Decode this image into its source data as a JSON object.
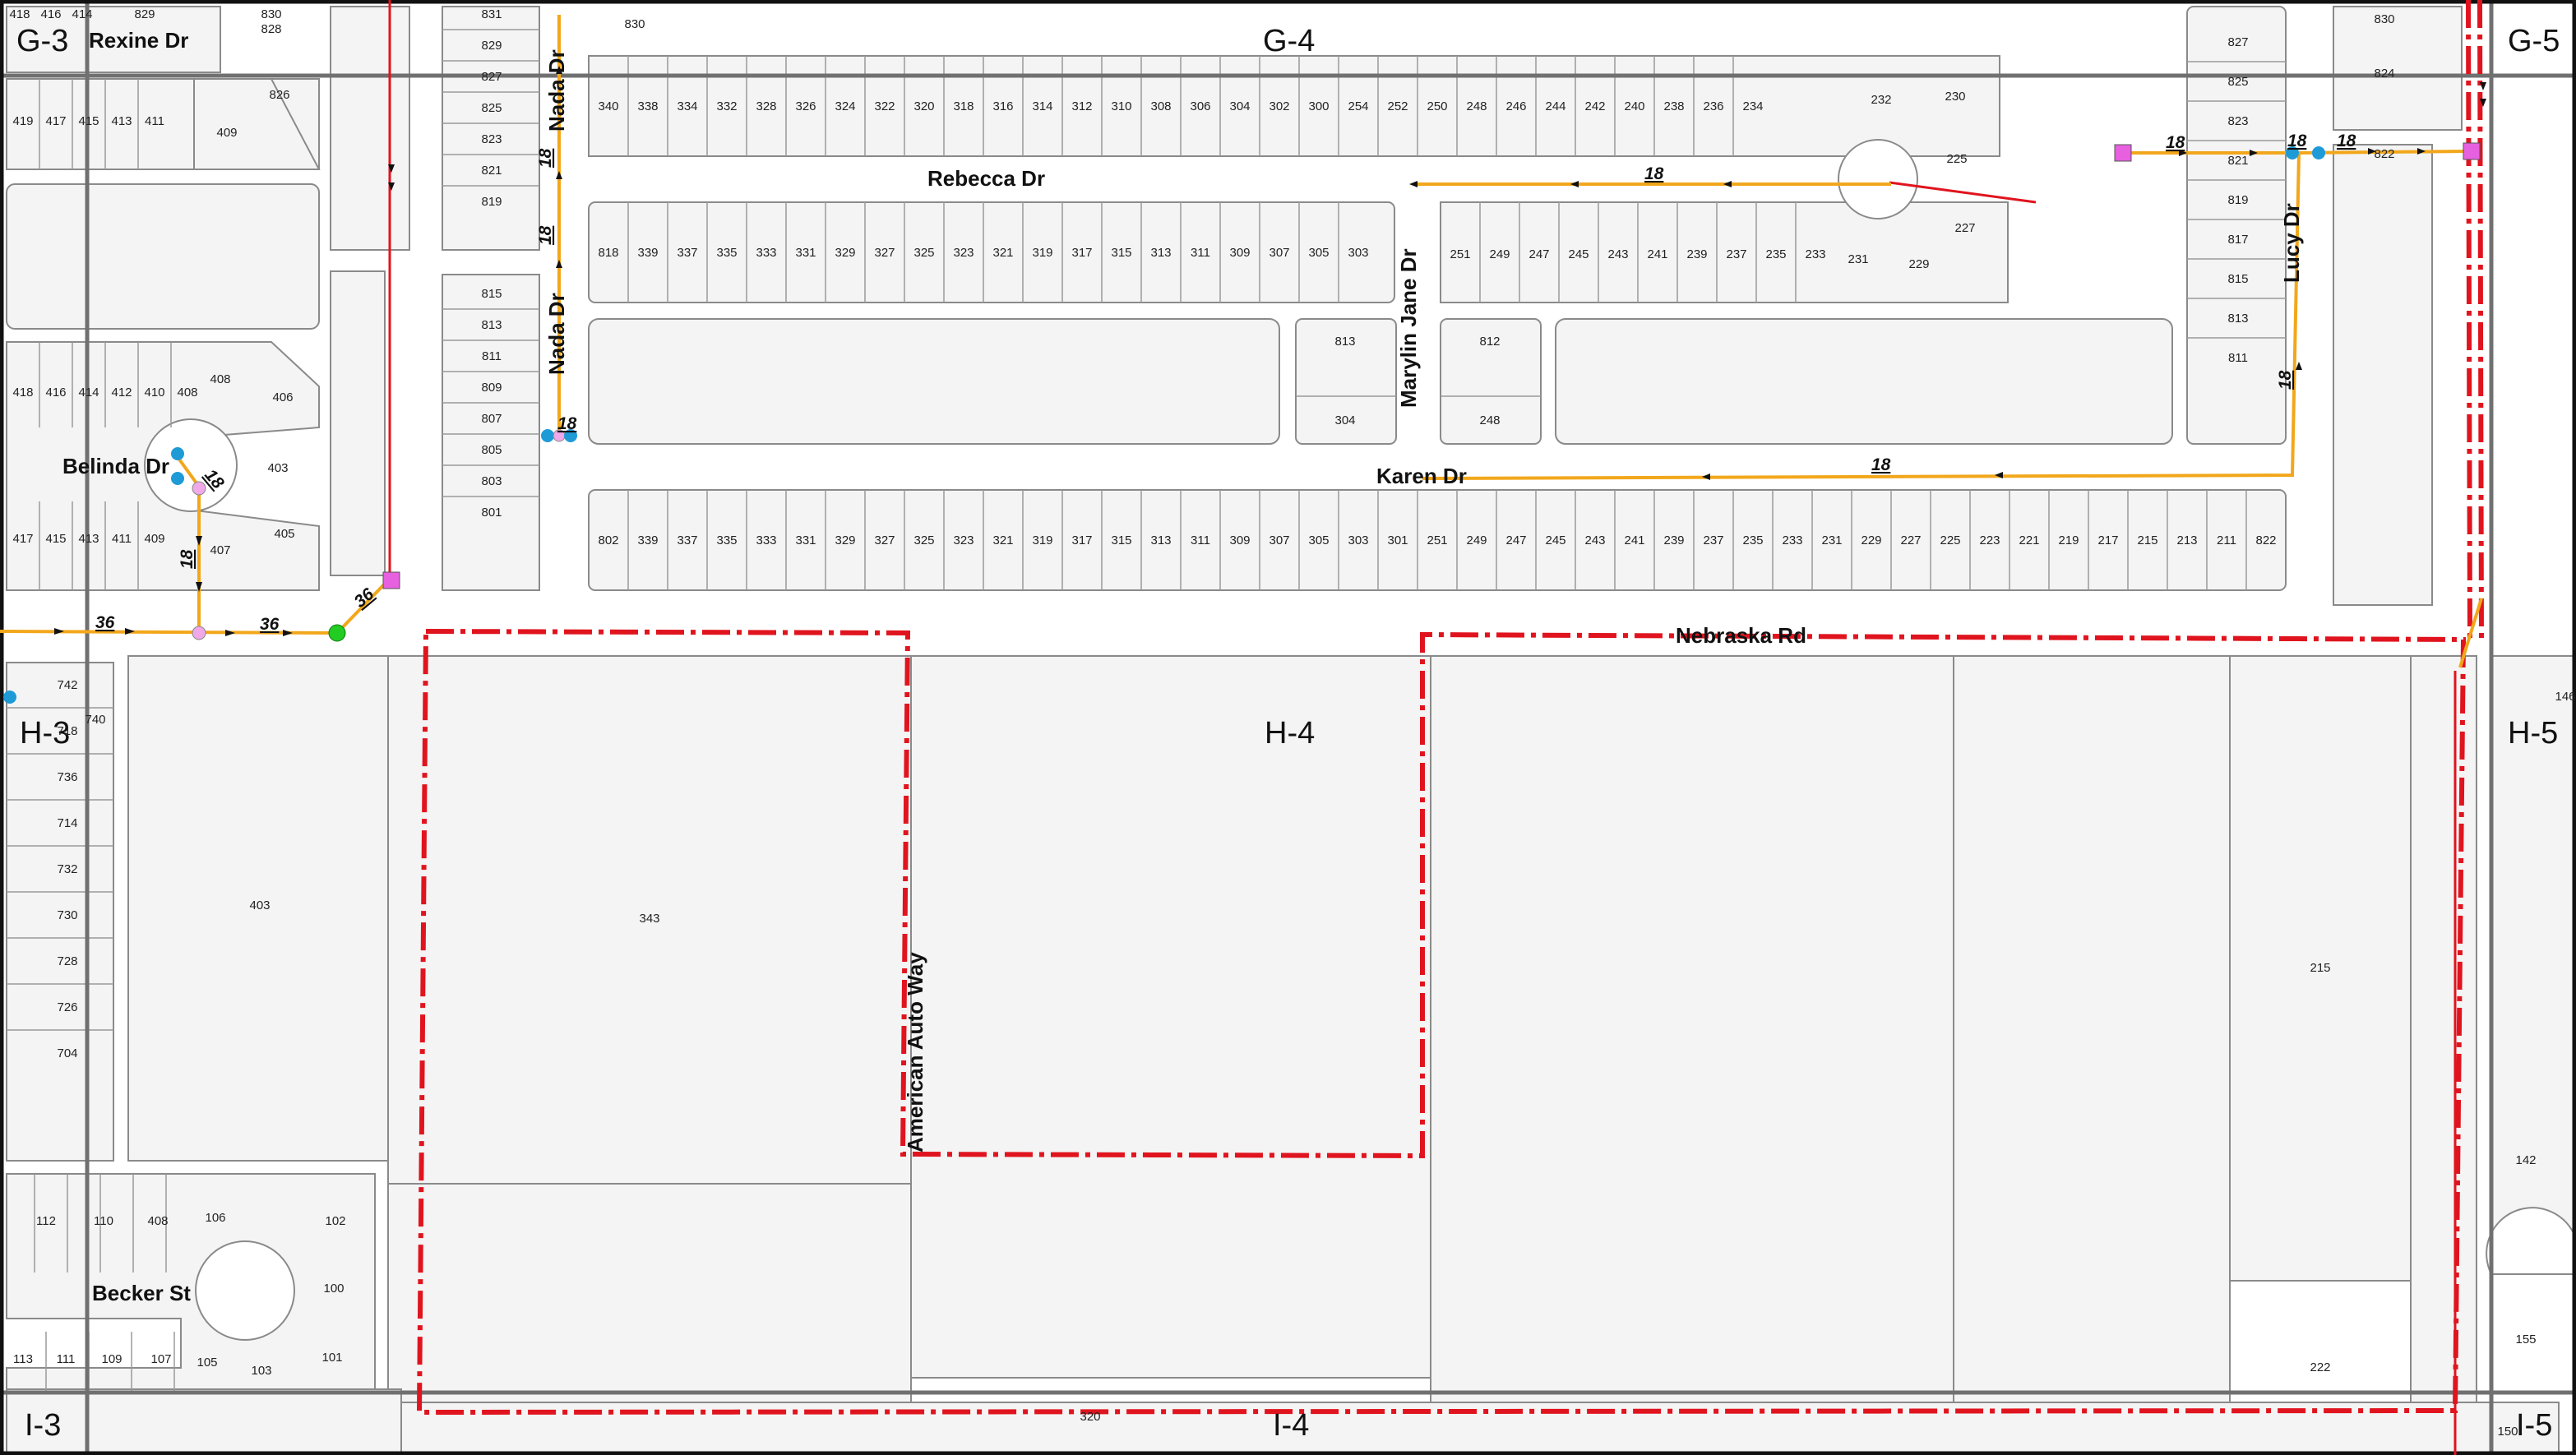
{
  "colors": {
    "background": "#ffffff",
    "parcel_fill": "#f4f4f4",
    "parcel_stroke": "#8a8a8a",
    "grid_line": "#707070",
    "route_line": "#f2a71b",
    "boundary_dashed": "#e0141e",
    "boundary_solid": "#e0141e",
    "stop_blue": "#1e9bd7",
    "stop_pink": "#f0a8e8",
    "stop_green": "#22cc22",
    "stop_magenta": "#e660e0"
  },
  "grid": {
    "cells": [
      "G-3",
      "G-4",
      "G-5",
      "H-3",
      "H-4",
      "H-5",
      "I-3",
      "I-4",
      "I-5"
    ]
  },
  "streets": {
    "rexine": "Rexine Dr",
    "nada_upper": "Nada Dr",
    "nada_lower": "Nada Dr",
    "rebecca": "Rebecca Dr",
    "marylin": "Marylin Jane Dr",
    "lucy": "Lucy Dr",
    "belinda": "Belinda Dr",
    "karen": "Karen Dr",
    "nebraska": "Nebraska Rd",
    "american": "American Auto Way",
    "becker": "Becker St"
  },
  "routes": {
    "r18": "18",
    "r36": "36"
  },
  "lots": {
    "top_left": [
      "418",
      "416",
      "414",
      "829",
      "830",
      "828"
    ],
    "g3_row": [
      "419",
      "417",
      "415",
      "413",
      "411",
      "409",
      "826"
    ],
    "belinda_top": [
      "418",
      "416",
      "414",
      "412",
      "410",
      "408",
      "406",
      "403"
    ],
    "belinda_bottom": [
      "417",
      "415",
      "413",
      "411",
      "409",
      "407",
      "405"
    ],
    "nada_col_upper": [
      "831",
      "829",
      "827",
      "825",
      "823",
      "821",
      "819"
    ],
    "nada_col_lower": [
      "815",
      "813",
      "811",
      "809",
      "807",
      "805",
      "803",
      "801"
    ],
    "top830": "830",
    "rebecca_north": [
      "340",
      "338",
      "334",
      "332",
      "328",
      "326",
      "324",
      "322",
      "320",
      "318",
      "316",
      "314",
      "312",
      "310",
      "308",
      "306",
      "304",
      "302",
      "300",
      "254",
      "252",
      "250",
      "248",
      "246",
      "244",
      "242",
      "240",
      "238",
      "236",
      "234",
      "232",
      "230",
      "225",
      "227",
      "229",
      "231"
    ],
    "rebecca_south_w": [
      "818",
      "339",
      "337",
      "335",
      "333",
      "331",
      "329",
      "327",
      "325",
      "323",
      "321",
      "319",
      "317",
      "315",
      "313",
      "311",
      "309",
      "307",
      "305",
      "303"
    ],
    "rebecca_south_e": [
      "251",
      "249",
      "247",
      "245",
      "243",
      "241",
      "239",
      "237",
      "235",
      "233"
    ],
    "marylin_w": [
      "813",
      "304"
    ],
    "marylin_e": [
      "812",
      "248"
    ],
    "lucy_col": [
      "827",
      "825",
      "823",
      "821",
      "819",
      "817",
      "815",
      "813",
      "811"
    ],
    "lucy_east": [
      "830",
      "824",
      "822"
    ],
    "karen_south": [
      "802",
      "339",
      "337",
      "335",
      "333",
      "331",
      "329",
      "327",
      "325",
      "323",
      "321",
      "319",
      "317",
      "315",
      "313",
      "311",
      "309",
      "307",
      "305",
      "303",
      "301",
      "251",
      "249",
      "247",
      "245",
      "243",
      "241",
      "239",
      "237",
      "235",
      "233",
      "231",
      "229",
      "227",
      "225",
      "223",
      "221",
      "219",
      "217",
      "215",
      "213",
      "211",
      "822"
    ],
    "h3_col": [
      "742",
      "740",
      "718",
      "736",
      "714",
      "732",
      "730",
      "728",
      "726",
      "704"
    ],
    "big": [
      "403",
      "343",
      "215",
      "222",
      "142",
      "155",
      "146",
      "320",
      "150"
    ],
    "becker": [
      "112",
      "110",
      "408",
      "106",
      "102",
      "100",
      "101",
      "103",
      "105",
      "107",
      "109",
      "111",
      "113"
    ]
  }
}
